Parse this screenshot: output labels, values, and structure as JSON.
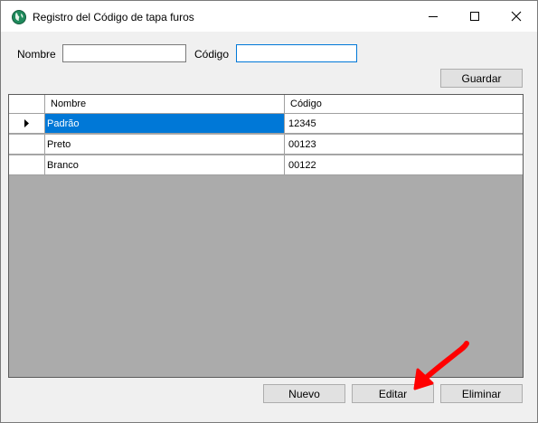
{
  "window": {
    "title": "Registro del Código de tapa furos",
    "icons": {
      "app": "app-globe-icon",
      "minimize": "minimize-icon",
      "maximize": "maximize-icon",
      "close": "close-icon"
    }
  },
  "form": {
    "nombre_label": "Nombre",
    "nombre_value": "",
    "codigo_label": "Código",
    "codigo_value": "",
    "guardar_label": "Guardar"
  },
  "grid": {
    "columns": [
      "Nombre",
      "Código"
    ],
    "rows": [
      {
        "nombre": "Padrão",
        "codigo": "12345",
        "current": true
      },
      {
        "nombre": "Preto",
        "codigo": "00123"
      },
      {
        "nombre": "Branco",
        "codigo": "00122"
      }
    ],
    "current_row_icon": "row-pointer-icon"
  },
  "actions": {
    "nuevo_label": "Nuevo",
    "editar_label": "Editar",
    "eliminar_label": "Eliminar"
  },
  "colors": {
    "selection": "#0078d7",
    "focus_border": "#0078d7",
    "grid_background": "#ababab",
    "annotation_arrow": "#ff0000"
  }
}
